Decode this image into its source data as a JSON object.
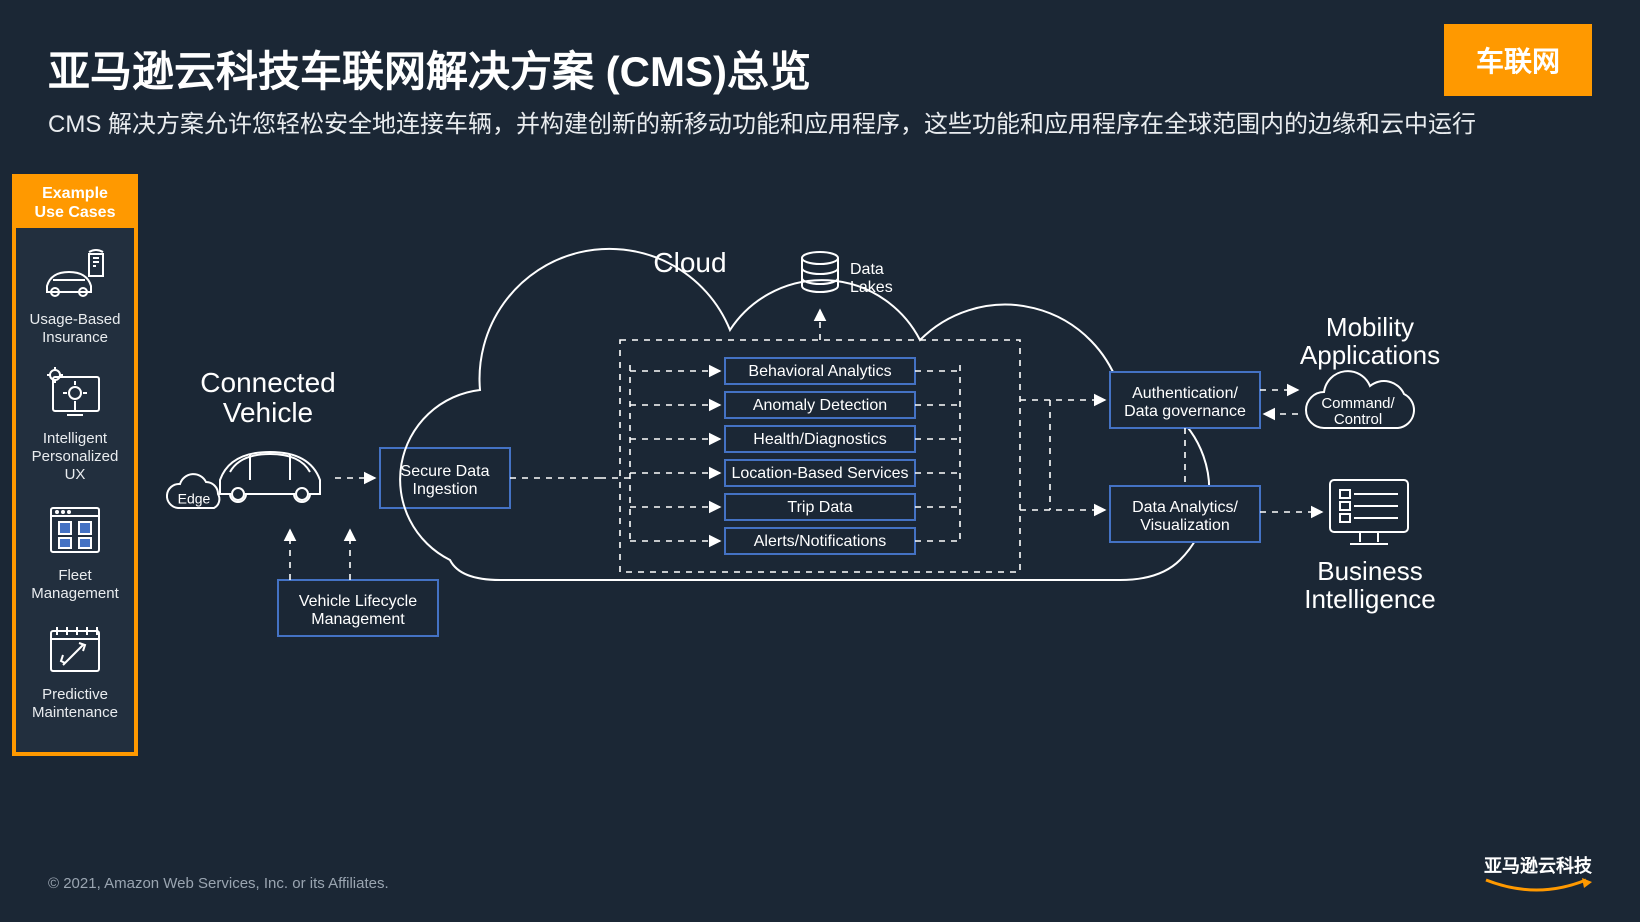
{
  "title": "亚马逊云科技车联网解决方案 (CMS)总览",
  "subtitle": "CMS 解决方案允许您轻松安全地连接车辆，并构建创新的新移动功能和应用程序，这些功能和应用程序在全球范围内的边缘和云中运行",
  "badge": "车联网",
  "sidebar": {
    "header_line1": "Example",
    "header_line2": "Use Cases",
    "items": [
      {
        "label_line1": "Usage-Based",
        "label_line2": "Insurance"
      },
      {
        "label_line1": "Intelligent",
        "label_line2": "Personalized",
        "label_line3": "UX"
      },
      {
        "label_line1": "Fleet",
        "label_line2": "Management"
      },
      {
        "label_line1": "Predictive",
        "label_line2": "Maintenance"
      }
    ]
  },
  "diagram": {
    "connected_vehicle": "Connected",
    "connected_vehicle2": "Vehicle",
    "edge": "Edge",
    "vehicle_lifecycle_line1": "Vehicle Lifecycle",
    "vehicle_lifecycle_line2": "Management",
    "secure_ingestion_line1": "Secure Data",
    "secure_ingestion_line2": "Ingestion",
    "cloud": "Cloud",
    "data_lakes_line1": "Data",
    "data_lakes_line2": "Lakes",
    "services": [
      "Behavioral Analytics",
      "Anomaly Detection",
      "Health/Diagnostics",
      "Location-Based Services",
      "Trip Data",
      "Alerts/Notifications"
    ],
    "auth_line1": "Authentication/",
    "auth_line2": "Data governance",
    "analytics_line1": "Data Analytics/",
    "analytics_line2": "Visualization",
    "mobility_line1": "Mobility",
    "mobility_line2": "Applications",
    "command_line1": "Command/",
    "command_line2": "Control",
    "bi_line1": "Business",
    "bi_line2": "Intelligence"
  },
  "footer": "© 2021, Amazon Web Services, Inc. or its Affiliates.",
  "logo": "亚马逊云科技"
}
